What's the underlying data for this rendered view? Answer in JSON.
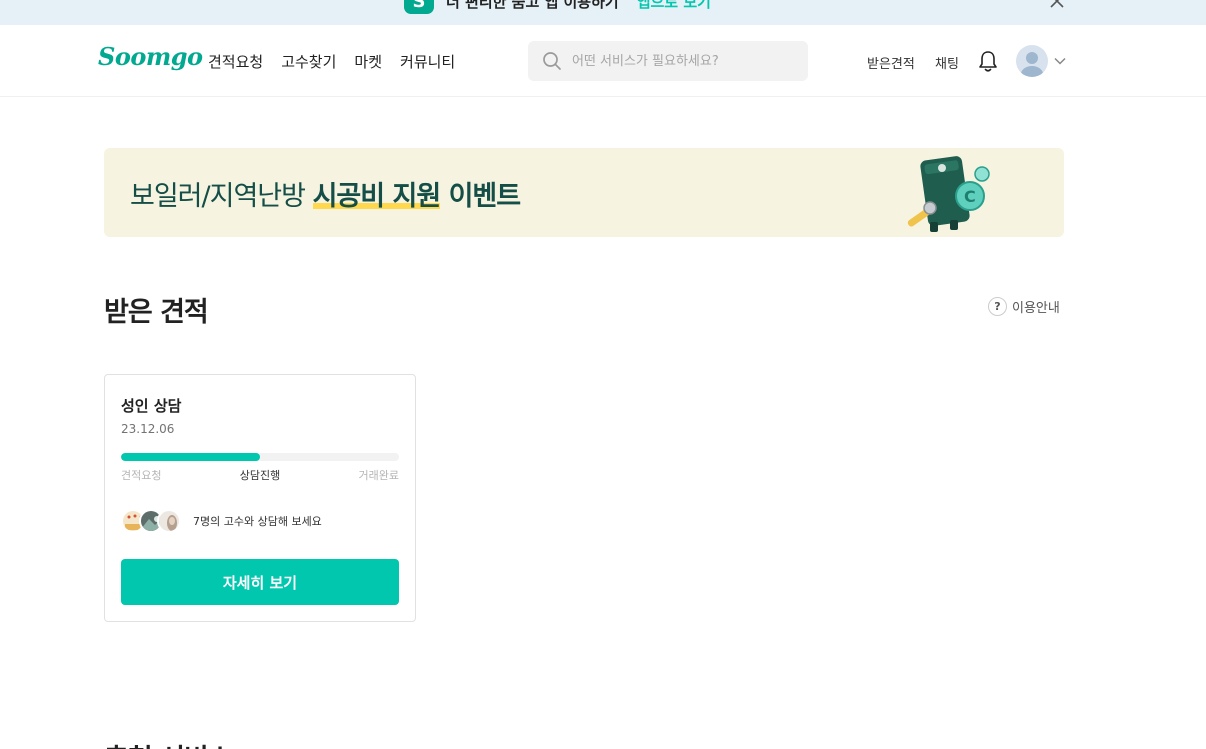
{
  "promo": {
    "text": "더 편리한 숨고 앱 이용하기",
    "link": "앱으로 보기"
  },
  "header": {
    "logo": "Soomgo",
    "nav": [
      "견적요청",
      "고수찾기",
      "마켓",
      "커뮤니티"
    ],
    "search_placeholder": "어떤 서비스가 필요하세요?",
    "received_quotes": "받은견적",
    "chat": "채팅"
  },
  "banner": {
    "text_plain": "보일러/지역난방 ",
    "text_strong": "시공비 지원",
    "text_tail": " 이벤트"
  },
  "section": {
    "title": "받은 견적",
    "help_label": "이용안내"
  },
  "card": {
    "title": "성인 상담",
    "date": "23.12.06",
    "progress": 0.5,
    "steps": [
      "견적요청",
      "상담진행",
      "거래완료"
    ],
    "active_step": 1,
    "pros_text": "7명의 고수와 상담해 보세요",
    "cta": "자세히 보기"
  },
  "next_section": {
    "title": "추천 서비스"
  },
  "colors": {
    "brand": "#00c7ae",
    "logo": "#00a98f",
    "banner_bg": "#f6f3e1",
    "banner_text": "#144e47"
  }
}
